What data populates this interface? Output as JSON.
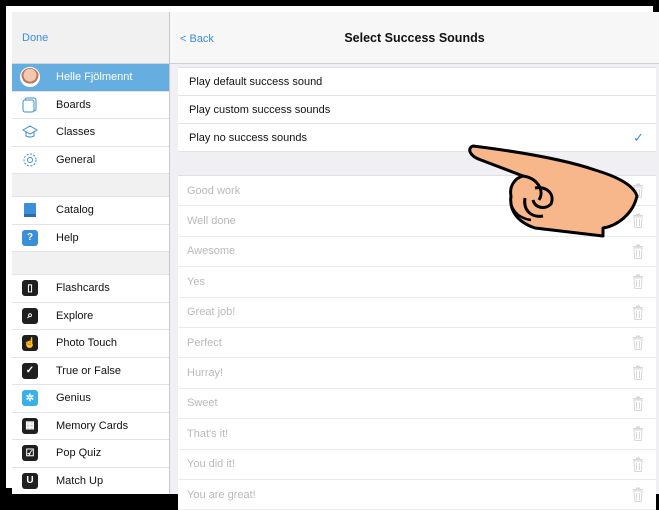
{
  "sidebar": {
    "done_label": "Done",
    "profile": {
      "name": "Helle Fjölmennt",
      "icon": "avatar"
    },
    "group1": [
      {
        "label": "Boards",
        "icon": "boards-icon"
      },
      {
        "label": "Classes",
        "icon": "classes-icon"
      },
      {
        "label": "General",
        "icon": "gear-icon"
      }
    ],
    "group2": [
      {
        "label": "Catalog",
        "icon": "catalog-icon"
      },
      {
        "label": "Help",
        "icon": "help-icon"
      }
    ],
    "group3": [
      {
        "label": "Flashcards",
        "icon": "flashcards-icon"
      },
      {
        "label": "Explore",
        "icon": "explore-icon"
      },
      {
        "label": "Photo Touch",
        "icon": "photo-touch-icon"
      },
      {
        "label": "True or False",
        "icon": "true-false-icon"
      },
      {
        "label": "Genius",
        "icon": "genius-icon"
      },
      {
        "label": "Memory Cards",
        "icon": "memory-cards-icon"
      },
      {
        "label": "Pop Quiz",
        "icon": "pop-quiz-icon"
      },
      {
        "label": "Match Up",
        "icon": "match-up-icon"
      }
    ]
  },
  "header": {
    "back_label": "< Back",
    "title": "Select Success Sounds"
  },
  "options": [
    {
      "label": "Play default success sound",
      "selected": false
    },
    {
      "label": "Play custom success sounds",
      "selected": false
    },
    {
      "label": "Play no success sounds",
      "selected": true
    }
  ],
  "checkmark": "✓",
  "sounds": [
    "Good work",
    "Well done",
    "Awesome",
    "Yes",
    "Great job!",
    "Perfect",
    "Hurray!",
    "Sweet",
    "That's it!",
    "You did it!",
    "You are great!"
  ],
  "colors": {
    "accent": "#3a8fd8",
    "selected_row": "#67aee0",
    "hand_fill": "#f8b78b"
  }
}
